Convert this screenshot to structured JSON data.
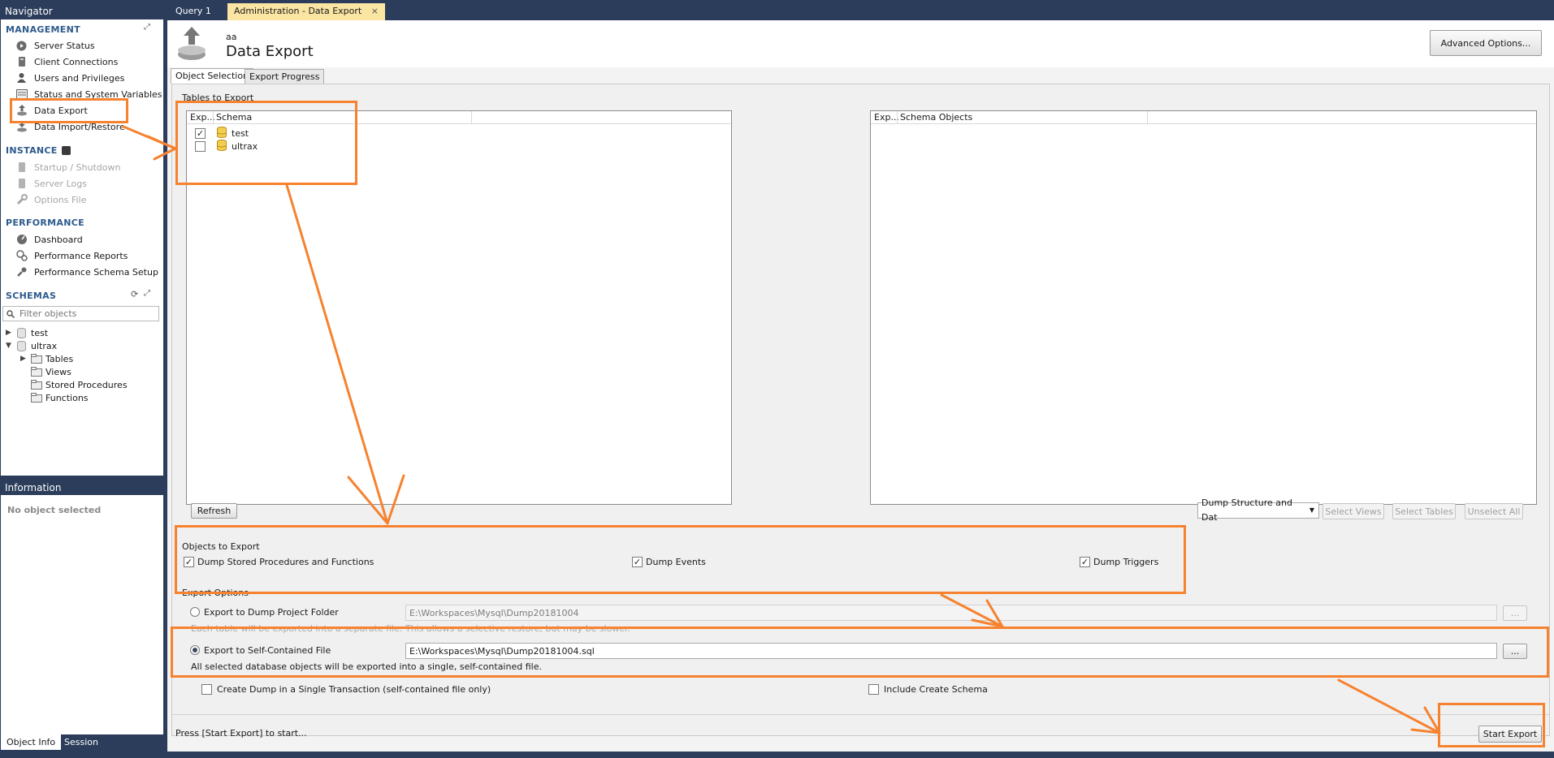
{
  "navigator": {
    "title": "Navigator",
    "sections": {
      "management": "MANAGEMENT",
      "instance": "INSTANCE",
      "performance": "PERFORMANCE",
      "schemas": "SCHEMAS"
    },
    "management_items": [
      {
        "label": "Server Status",
        "icon": "server-status-icon"
      },
      {
        "label": "Client Connections",
        "icon": "client-connections-icon"
      },
      {
        "label": "Users and Privileges",
        "icon": "users-icon"
      },
      {
        "label": "Status and System Variables",
        "icon": "variables-icon"
      },
      {
        "label": "Data Export",
        "icon": "data-export-icon"
      },
      {
        "label": "Data Import/Restore",
        "icon": "data-import-icon"
      }
    ],
    "instance_items": [
      {
        "label": "Startup / Shutdown",
        "icon": "startup-icon"
      },
      {
        "label": "Server Logs",
        "icon": "server-logs-icon"
      },
      {
        "label": "Options File",
        "icon": "wrench-icon"
      }
    ],
    "performance_items": [
      {
        "label": "Dashboard",
        "icon": "dashboard-icon"
      },
      {
        "label": "Performance Reports",
        "icon": "reports-icon"
      },
      {
        "label": "Performance Schema Setup",
        "icon": "schema-setup-icon"
      }
    ],
    "filter_placeholder": "Filter objects",
    "tree": {
      "schema1": "test",
      "schema2": "ultrax",
      "children": [
        "Tables",
        "Views",
        "Stored Procedures",
        "Functions"
      ]
    }
  },
  "information": {
    "title": "Information",
    "empty_text": "No object selected",
    "tabs": [
      "Object Info",
      "Session"
    ]
  },
  "doc_tabs": [
    {
      "label": "Query 1"
    },
    {
      "label": "Administration - Data Export",
      "close": "×"
    }
  ],
  "header": {
    "connection": "aa",
    "title": "Data Export",
    "advanced_button": "Advanced Options..."
  },
  "sub_tabs": [
    "Object Selection",
    "Export Progress"
  ],
  "tables_to_export": {
    "group_label": "Tables to Export",
    "left_columns": [
      "Exp...",
      "Schema"
    ],
    "right_columns": [
      "Exp...",
      "Schema Objects"
    ],
    "schemas": [
      {
        "name": "test",
        "checked": "✓"
      },
      {
        "name": "ultrax",
        "checked": ""
      }
    ],
    "refresh_button": "Refresh",
    "dump_select": "Dump Structure and Dat",
    "select_views_button": "Select Views",
    "select_tables_button": "Select Tables",
    "unselect_all_button": "Unselect All"
  },
  "objects_to_export": {
    "group_label": "Objects to Export",
    "items": [
      "Dump Stored Procedures and Functions",
      "Dump Events",
      "Dump Triggers"
    ],
    "check_mark": "✓"
  },
  "export_options": {
    "group_label": "Export Options",
    "folder_label": "Export to Dump Project Folder",
    "folder_path": "E:\\Workspaces\\Mysql\\Dump20181004",
    "folder_hint": "Each table will be exported into a separate file. This allows a selective restore, but may be slower.",
    "file_label": "Export to Self-Contained File",
    "file_path": "E:\\Workspaces\\Mysql\\Dump20181004.sql",
    "file_hint": "All selected database objects will be exported into a single, self-contained file.",
    "browse_button": "...",
    "single_transaction_label": "Create Dump in a Single Transaction (self-contained file only)",
    "include_schema_label": "Include Create Schema"
  },
  "footer": {
    "status": "Press [Start Export] to start...",
    "start_button": "Start Export"
  },
  "colors": {
    "annotation": "#f6822f",
    "navigator_bg": "#2b3d5b",
    "active_tab": "#fbe5a3"
  }
}
